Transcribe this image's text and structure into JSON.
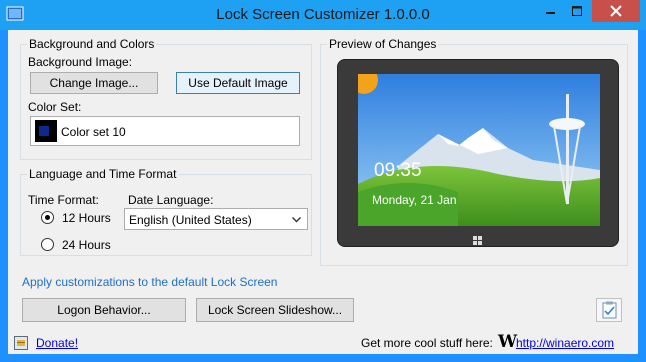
{
  "window": {
    "title": "Lock Screen Customizer 1.0.0.0"
  },
  "background_group": {
    "title": "Background and Colors",
    "background_image_label": "Background Image:",
    "change_image_button": "Change Image...",
    "use_default_button": "Use Default Image",
    "color_set_label": "Color Set:",
    "color_set_value": "Color set 10"
  },
  "language_group": {
    "title": "Language and Time Format",
    "time_format_label": "Time Format:",
    "time_12": "12 Hours",
    "time_24": "24 Hours",
    "date_language_label": "Date Language:",
    "date_language_value": "English (United States)"
  },
  "preview": {
    "title": "Preview of Changes",
    "time": "09:35",
    "date": "Monday, 21 Jan"
  },
  "apply_link": "Apply customizations to the default Lock Screen",
  "logon_behavior_button": "Logon Behavior...",
  "slideshow_button": "Lock Screen Slideshow...",
  "footer": {
    "donate_link": "Donate!",
    "more_text": "Get more cool stuff here:",
    "winaero_logo": "W",
    "winaero_link": "http://winaero.com"
  },
  "colors": {
    "titlebar": "#1ea1f3",
    "close_button": "#c7504a",
    "color_swatch": "#0a2b8c"
  }
}
